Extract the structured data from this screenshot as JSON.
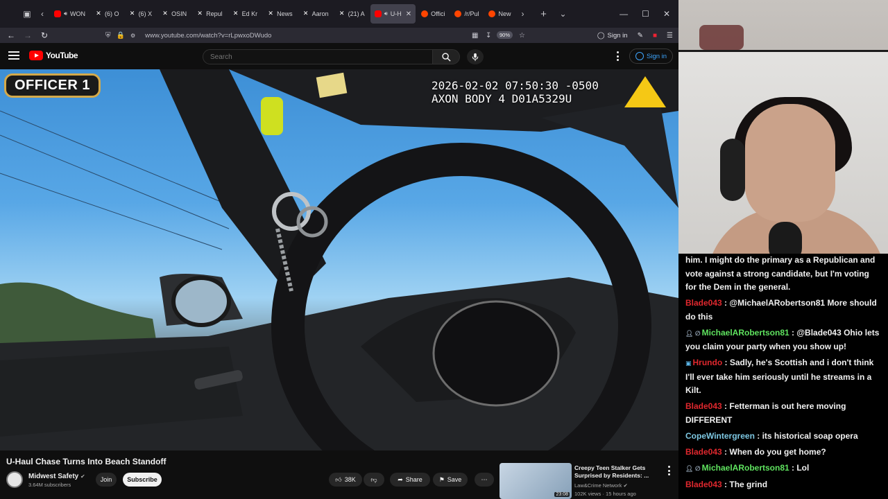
{
  "browser": {
    "tabs": [
      {
        "icon": "youtube",
        "label": "WON",
        "audio": true
      },
      {
        "icon": "x",
        "label": "(6) O"
      },
      {
        "icon": "x",
        "label": "(6) X"
      },
      {
        "icon": "x",
        "label": "OSIN"
      },
      {
        "icon": "x",
        "label": "Repul"
      },
      {
        "icon": "x",
        "label": "Ed Kr"
      },
      {
        "icon": "x",
        "label": "News"
      },
      {
        "icon": "x",
        "label": "Aaron"
      },
      {
        "icon": "x",
        "label": "(21) A"
      },
      {
        "icon": "youtube",
        "label": "U-H",
        "audio": true,
        "active": true
      },
      {
        "icon": "reddit",
        "label": "Offici"
      },
      {
        "icon": "reddit",
        "label": "/r/Pul"
      },
      {
        "icon": "reddit",
        "label": "New"
      }
    ],
    "url": "www.youtube.com/watch?v=rLpwxoDWudo",
    "zoom": "90%",
    "sign_in": "Sign in"
  },
  "youtube": {
    "logo_text": "YouTube",
    "search_placeholder": "Search",
    "sign_in": "Sign in"
  },
  "video": {
    "officer_label": "OFFICER 1",
    "timestamp": "2026-02-02 07:50:30 -0500",
    "device": "AXON BODY 4 D01A5329U",
    "title": "U-Haul Chase Turns Into Beach Standoff",
    "channel": "Midwest Safety",
    "subscribers": "3.64M subscribers",
    "join": "Join",
    "subscribe": "Subscribe",
    "likes": "38K",
    "share": "Share",
    "save": "Save"
  },
  "recommendation": {
    "title": "Creepy Teen Stalker Gets Surprised by Residents: ...",
    "channel": "Law&Crime Network",
    "meta": "102K views · 15 hours ago",
    "duration": "23:08"
  },
  "chat": [
    {
      "user": "",
      "color": "#f1f1f1",
      "text": "him. I might do the primary as a Republican and vote against a strong candidate, but I'm voting for the Dem in the general."
    },
    {
      "user": "Blade043",
      "color": "#e0282e",
      "text": "@MichaelARobertson81 More should do this"
    },
    {
      "user": "MichaelARobertson81",
      "color": "#5fe35f",
      "badges": true,
      "text": "@Blade043 Ohio lets you claim your party when you show up!"
    },
    {
      "user": "Hrundo",
      "color": "#e0282e",
      "badge_tv": true,
      "text": "Sadly, he's Scottish and i don't think I'll ever take him seriously until he streams in a Kilt."
    },
    {
      "user": "Blade043",
      "color": "#e0282e",
      "text": "Fetterman is out here moving DIFFERENT"
    },
    {
      "user": "CopeWintergreen",
      "color": "#7ec8e3",
      "text": "its historical soap opera"
    },
    {
      "user": "Blade043",
      "color": "#e0282e",
      "text": "When do you get home?"
    },
    {
      "user": "MichaelARobertson81",
      "color": "#5fe35f",
      "badges": true,
      "text": "Lol"
    },
    {
      "user": "Blade043",
      "color": "#e0282e",
      "text": "The grind"
    }
  ]
}
